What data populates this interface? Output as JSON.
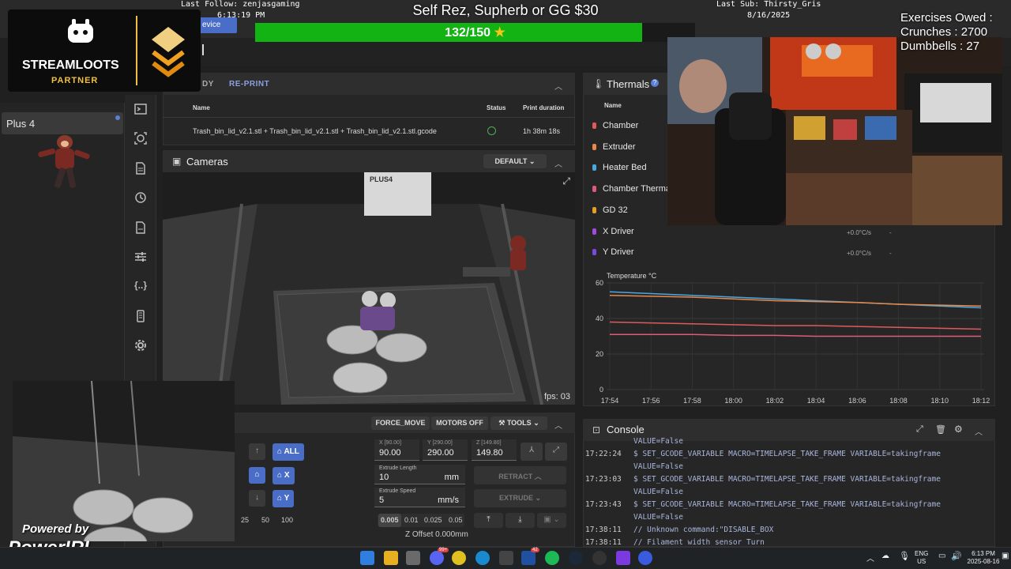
{
  "overlay": {
    "last_follow": "Last Follow: zenjasgaming",
    "follow_time": "6:13:19 PM",
    "last_sub": "Last Sub: Thirsty_Gris",
    "sub_date": "8/16/2025",
    "goal_title": "Self Rez, Supherb or GG $30",
    "progress_text": "132/150",
    "progress_fraction": 0.88,
    "exercises_title": "Exercises Owed :",
    "crunches": "Crunches : 2700",
    "dumbbells": "Dumbbells : 27",
    "streamloots": "STREAMLOOTS",
    "partner": "PARTNER",
    "powered_by": "Powered by",
    "powerirl": "PowerIRL",
    "device_tab": "evice"
  },
  "sidebar": {
    "device_name": "Plus 4"
  },
  "job_queue": {
    "tabs": [
      "DY",
      "RE-PRINT"
    ],
    "columns": [
      "Name",
      "Status",
      "Print duration"
    ],
    "rows": [
      {
        "name": "Trash_bin_lid_v2.1.stl + Trash_bin_lid_v2.1.stl + Trash_bin_lid_v2.1.stl.gcode",
        "duration": "1h 38m 18s"
      }
    ]
  },
  "cameras": {
    "title": "Cameras",
    "camera_select": "DEFAULT",
    "fps": "fps: 03",
    "printer_brand": "PLUS4"
  },
  "tools": {
    "force_move": "FORCE_MOVE",
    "motors_off": "MOTORS OFF",
    "tools_menu": "TOOLS",
    "home_all": "ALL",
    "home_x": "X",
    "home_y": "Y",
    "steps": [
      "25",
      "50",
      "100"
    ],
    "positions": [
      {
        "label": "X [90.00]",
        "value": "90.00"
      },
      {
        "label": "Y [290.00]",
        "value": "290.00"
      },
      {
        "label": "Z [149.80]",
        "value": "149.80"
      }
    ],
    "extrude_length_label": "Extrude Length",
    "extrude_length": "10",
    "extrude_length_unit": "mm",
    "extrude_speed_label": "Extrude Speed",
    "extrude_speed": "5",
    "extrude_speed_unit": "mm/s",
    "retract": "RETRACT",
    "extrude": "EXTRUDE",
    "z_multipliers": [
      "0.005",
      "0.01",
      "0.025",
      "0.05"
    ],
    "z_offset": "Z Offset 0.000mm"
  },
  "thermals": {
    "title": "Thermals",
    "name_col": "Name",
    "sensors": [
      {
        "name": "Chamber",
        "color": "#e05a5a",
        "value": "",
        "target": ""
      },
      {
        "name": "Extruder",
        "color": "#e8884a",
        "value": "",
        "target": ""
      },
      {
        "name": "Heater Bed",
        "color": "#4aa8e0",
        "value": "",
        "target": ""
      },
      {
        "name": "Chamber Therma",
        "color": "#e05a7a",
        "value": "",
        "target": ""
      },
      {
        "name": "GD 32",
        "color": "#e8a020",
        "value": "",
        "target": ""
      },
      {
        "name": "X Driver",
        "color": "#a04ae0",
        "value": "+0.0°C/s",
        "target": "-"
      },
      {
        "name": "Y Driver",
        "color": "#7a4ae0",
        "value": "+0.0°C/s",
        "target": "-"
      }
    ]
  },
  "chart_data": {
    "type": "line",
    "ylabel": "Temperature °C",
    "ylim": [
      0,
      60
    ],
    "yticks": [
      "0",
      "20",
      "40",
      "60"
    ],
    "x": [
      "17:54",
      "17:56",
      "17:58",
      "18:00",
      "18:02",
      "18:04",
      "18:06",
      "18:08",
      "18:10",
      "18:12"
    ],
    "series": [
      {
        "color": "#4aa8e0",
        "values": [
          55,
          54,
          53,
          52,
          51,
          50,
          49,
          48,
          47,
          46
        ]
      },
      {
        "color": "#e8884a",
        "values": [
          53,
          52.5,
          52,
          51,
          50,
          49.5,
          49,
          48,
          47.5,
          47
        ]
      },
      {
        "color": "#e05a5a",
        "values": [
          38,
          37.5,
          37,
          36.5,
          36,
          36,
          35.5,
          35,
          34.5,
          34
        ]
      },
      {
        "color": "#e05a7a",
        "values": [
          31,
          31,
          31,
          30.5,
          30.5,
          30,
          30,
          30,
          30,
          30
        ]
      }
    ],
    "grid": true
  },
  "console": {
    "title": "Console",
    "lines": [
      {
        "time": "",
        "text": "VALUE=False"
      },
      {
        "time": "17:22:24",
        "text": "$ SET_GCODE_VARIABLE MACRO=TIMELAPSE_TAKE_FRAME VARIABLE=takingframe"
      },
      {
        "time": "",
        "text": "VALUE=False"
      },
      {
        "time": "17:23:03",
        "text": "$ SET_GCODE_VARIABLE MACRO=TIMELAPSE_TAKE_FRAME VARIABLE=takingframe"
      },
      {
        "time": "",
        "text": "VALUE=False"
      },
      {
        "time": "17:23:43",
        "text": "$ SET_GCODE_VARIABLE MACRO=TIMELAPSE_TAKE_FRAME VARIABLE=takingframe"
      },
      {
        "time": "",
        "text": "VALUE=False"
      },
      {
        "time": "17:38:11",
        "text": "// Unknown command:\"DISABLE_BOX"
      },
      {
        "time": "17:38:11",
        "text": "// Filament width sensor Turn"
      }
    ]
  },
  "taskbar": {
    "badge_discord": "99+",
    "badge_mail": "42",
    "lang": "ENG",
    "region": "US",
    "time": "6:13 PM",
    "date": "2025-08-16"
  }
}
